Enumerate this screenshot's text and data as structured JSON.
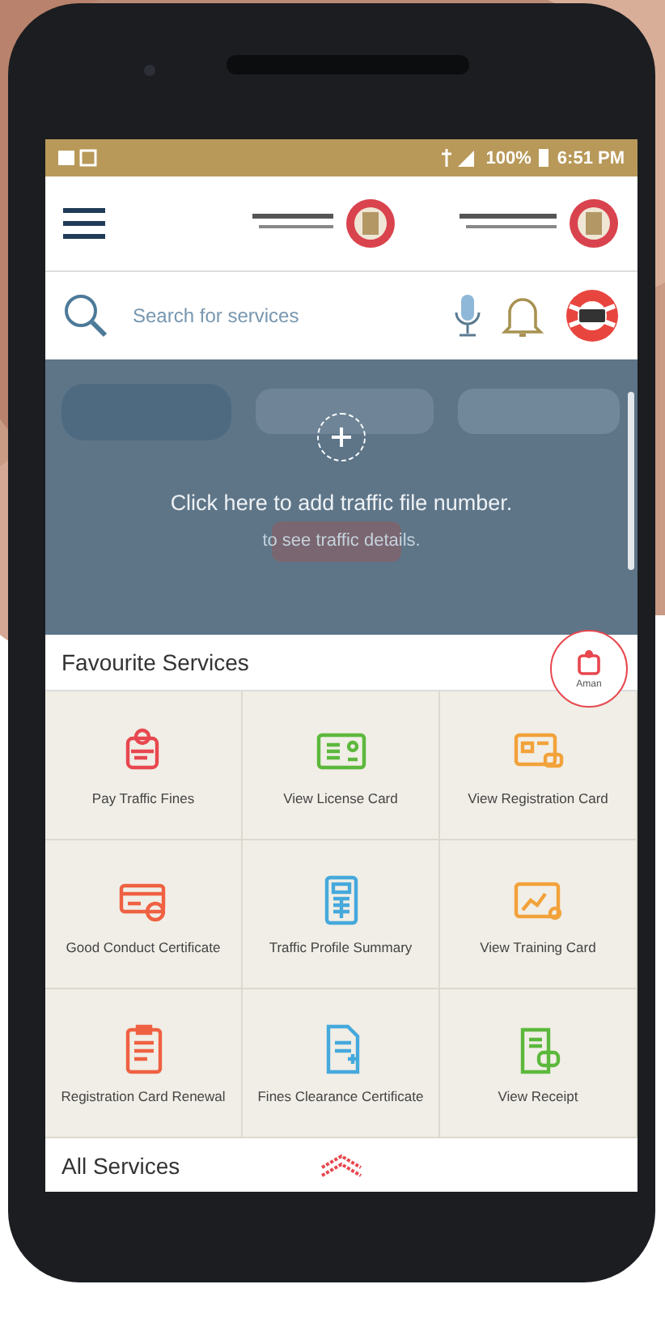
{
  "status_bar": {
    "battery": "100%",
    "time": "6:51 PM"
  },
  "search": {
    "placeholder": "Search for services"
  },
  "banner": {
    "title": "Click here to add traffic file number.",
    "subtitle": "to see traffic details."
  },
  "favourites": {
    "title": "Favourite Services",
    "floating_label": "Aman",
    "services": [
      {
        "label": "Pay Traffic Fines",
        "kind": "fines",
        "color": "#e8474f"
      },
      {
        "label": "View License Card",
        "kind": "license",
        "color": "#5cb83c"
      },
      {
        "label": "View Registration Card",
        "kind": "registration",
        "color": "#f2a23a"
      },
      {
        "label": "Good Conduct Certificate",
        "kind": "conduct",
        "color": "#ef6142"
      },
      {
        "label": "Traffic Profile Summary",
        "kind": "profile",
        "color": "#45a9dc"
      },
      {
        "label": "View Training Card",
        "kind": "training",
        "color": "#f2a23a"
      },
      {
        "label": "Registration Card Renewal",
        "kind": "renewal",
        "color": "#ef6142"
      },
      {
        "label": "Fines Clearance Certificate",
        "kind": "clearance",
        "color": "#45a9dc"
      },
      {
        "label": "View Receipt",
        "kind": "receipt",
        "color": "#5cb83c"
      }
    ]
  },
  "all_services": {
    "title": "All Services"
  }
}
